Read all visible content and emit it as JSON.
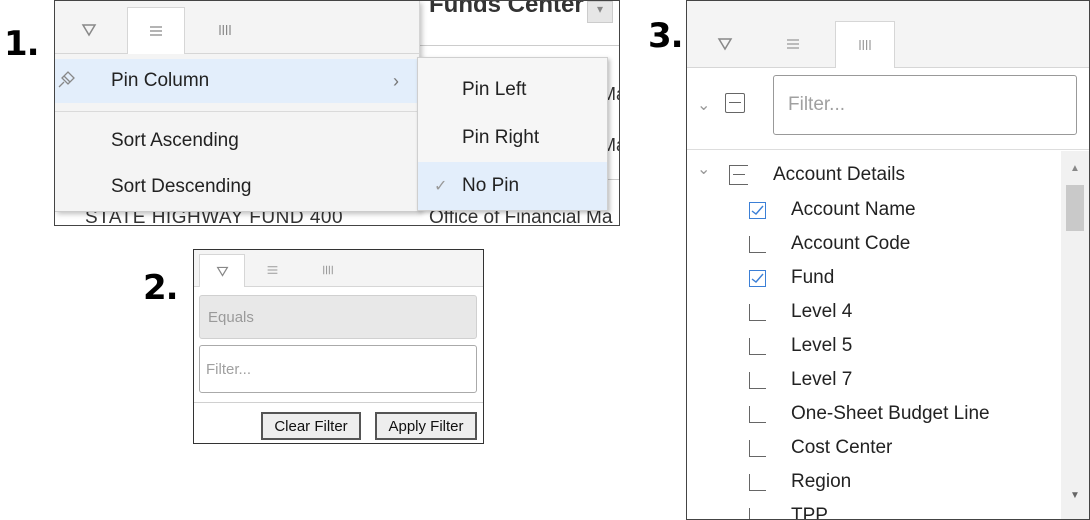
{
  "labels": {
    "one": "1.",
    "two": "2.",
    "three": "3."
  },
  "panel1": {
    "background": {
      "header": "Funds Center",
      "row_text": "STATE HIGHWAY FUND 400",
      "row_text_right": "Office of Financial Ma",
      "fragment_1": "Ma",
      "fragment_2": "Ma"
    },
    "tabs": [
      "filter-icon",
      "menu-icon",
      "columns-icon"
    ],
    "menu": {
      "pin_column": "Pin Column",
      "sort_ascending": "Sort Ascending",
      "sort_descending": "Sort Descending"
    },
    "submenu": {
      "pin_left": "Pin Left",
      "pin_right": "Pin Right",
      "no_pin": "No Pin",
      "selected": "No Pin"
    }
  },
  "panel2": {
    "equals": "Equals",
    "filter_placeholder": "Filter...",
    "clear_filter": "Clear Filter",
    "apply_filter": "Apply Filter"
  },
  "panel3": {
    "filter_placeholder": "Filter...",
    "group_label": "Account Details",
    "columns": [
      {
        "label": "Account Name",
        "checked": true
      },
      {
        "label": "Account Code",
        "checked": false
      },
      {
        "label": "Fund",
        "checked": true
      },
      {
        "label": "Level 4",
        "checked": false
      },
      {
        "label": "Level 5",
        "checked": false
      },
      {
        "label": "Level 7",
        "checked": false
      },
      {
        "label": "One-Sheet Budget Line",
        "checked": false
      },
      {
        "label": "Cost Center",
        "checked": false
      },
      {
        "label": "Region",
        "checked": false
      },
      {
        "label": "TPP",
        "checked": false
      }
    ]
  },
  "colors": {
    "highlight": "#e3eefb",
    "check_blue": "#3b7fd6",
    "menu_bg": "#f4f4f4"
  }
}
